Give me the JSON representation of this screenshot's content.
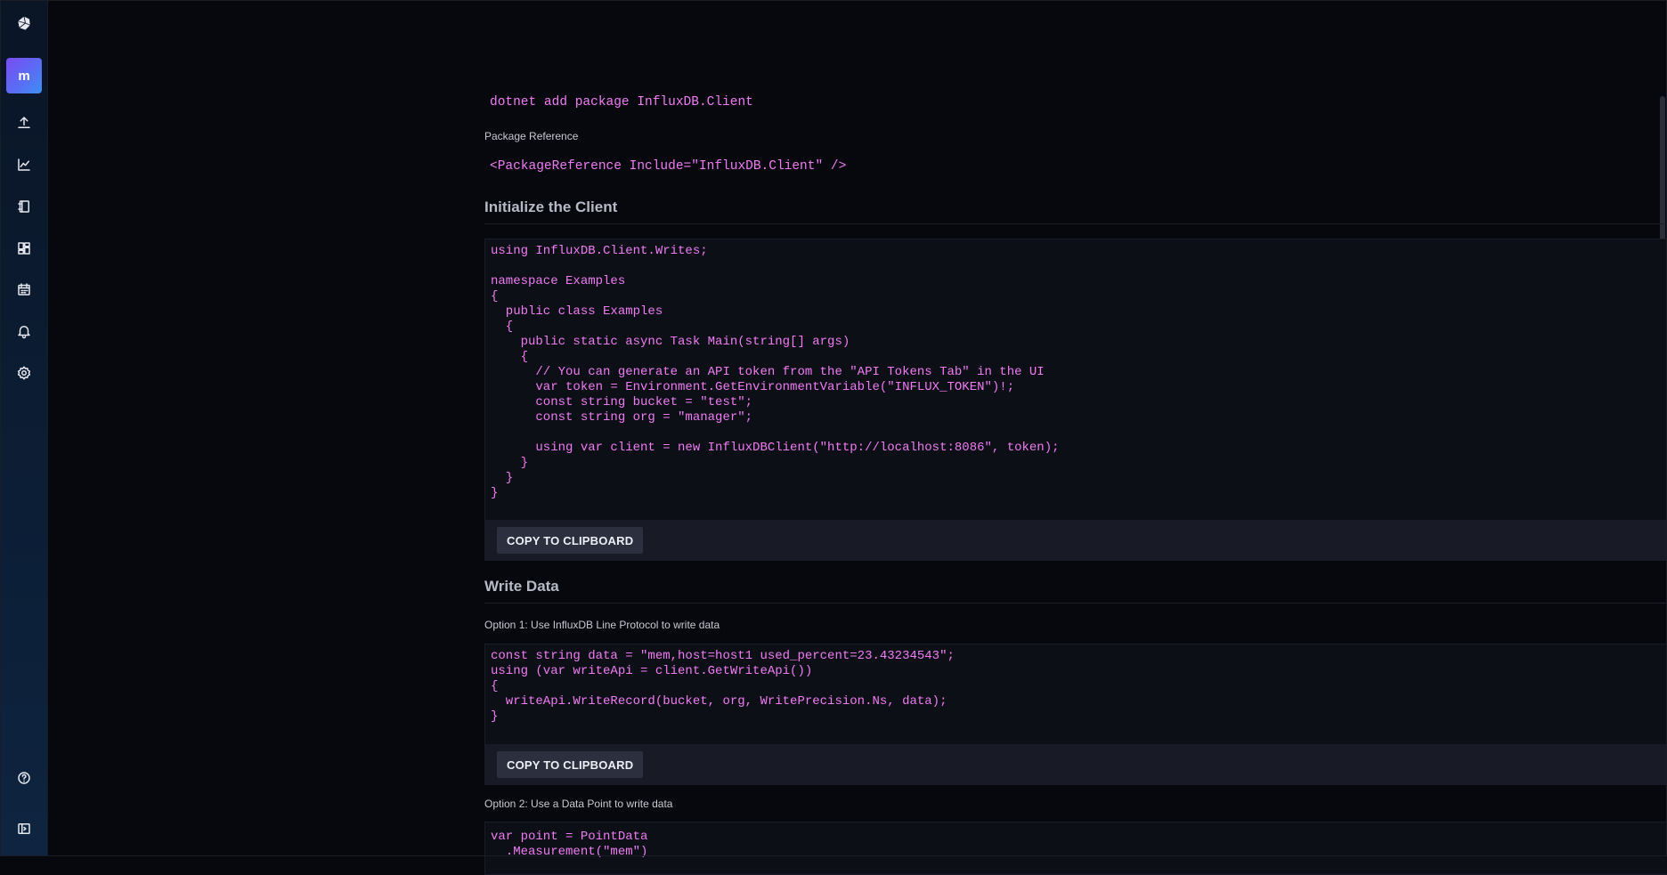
{
  "sidebar": {
    "logo": "influx-cube-icon",
    "org_initial": "m",
    "items": [
      {
        "name": "upload-icon"
      },
      {
        "name": "graph-icon"
      },
      {
        "name": "notebook-icon"
      },
      {
        "name": "dashboards-icon"
      },
      {
        "name": "tasks-calendar-icon"
      },
      {
        "name": "alerts-bell-icon"
      },
      {
        "name": "settings-gear-icon"
      }
    ],
    "bottom": [
      {
        "name": "help-icon"
      },
      {
        "name": "collapse-sidebar-icon"
      }
    ]
  },
  "install": {
    "command": "dotnet add package InfluxDB.Client",
    "package_reference_label": "Package Reference",
    "package_reference_code": "<PackageReference Include=\"InfluxDB.Client\" />"
  },
  "init_client": {
    "title": "Initialize the Client",
    "code": "using InfluxDB.Client.Writes;\n\nnamespace Examples\n{\n  public class Examples\n  {\n    public static async Task Main(string[] args)\n    {\n      // You can generate an API token from the \"API Tokens Tab\" in the UI\n      var token = Environment.GetEnvironmentVariable(\"INFLUX_TOKEN\")!;\n      const string bucket = \"test\";\n      const string org = \"manager\";\n\n      using var client = new InfluxDBClient(\"http://localhost:8086\", token);\n    }\n  }\n}",
    "copy_label": "COPY TO CLIPBOARD"
  },
  "write_data": {
    "title": "Write Data",
    "option1_label": "Option 1: Use InfluxDB Line Protocol to write data",
    "option1_code": "const string data = \"mem,host=host1 used_percent=23.43234543\";\nusing (var writeApi = client.GetWriteApi())\n{\n  writeApi.WriteRecord(bucket, org, WritePrecision.Ns, data);\n}",
    "copy_label": "COPY TO CLIPBOARD",
    "option2_label": "Option 2: Use a Data Point to write data",
    "option2_code": "var point = PointData\n  .Measurement(\"mem\")"
  }
}
